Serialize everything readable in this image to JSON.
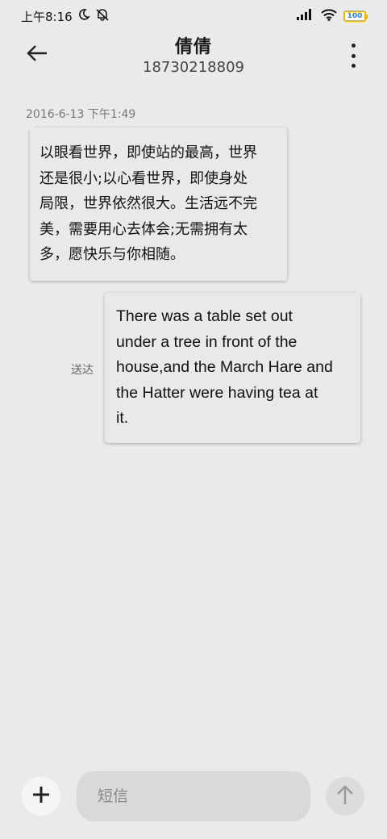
{
  "status_bar": {
    "time": "上午8:16",
    "battery_level": "100",
    "icons": [
      "moon-icon",
      "mute-notifications-icon",
      "signal-icon",
      "wifi-icon",
      "battery-icon"
    ]
  },
  "header": {
    "contact_name": "倩倩",
    "contact_number": "18730218809",
    "back_icon": "arrow-left-icon",
    "more_icon": "more-vertical-icon"
  },
  "thread": {
    "timestamp": "2016-6-13 下午1:49",
    "messages": [
      {
        "direction": "incoming",
        "lines": [
          "以眼看世界，即使站的最高，世界",
          "还是很小;以心看世界，即使身处",
          "局限，世界依然很大。生活远不完",
          "美，需要用心去体会;无需拥有太",
          "多，愿快乐与你相随。"
        ]
      },
      {
        "direction": "outgoing",
        "lines": [
          "There was a table set out",
          "under a tree in front of the",
          "house,and the March Hare and",
          "the Hatter were having tea at",
          "it."
        ],
        "status": "送达"
      }
    ]
  },
  "composer": {
    "placeholder": "短信",
    "add_icon": "plus-icon",
    "send_icon": "arrow-up-icon"
  }
}
